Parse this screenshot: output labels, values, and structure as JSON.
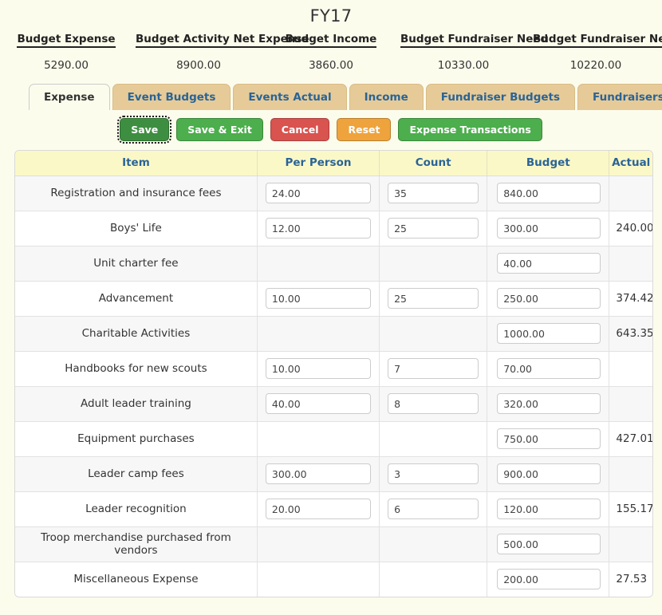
{
  "title": "FY17",
  "summary": {
    "headers": [
      "Budget Expense",
      "Budget Activity Net Expense",
      "Budget Income",
      "Budget Fundraiser Need",
      "Budget Fundraiser Net Income"
    ],
    "values": [
      "5290.00",
      "8900.00",
      "3860.00",
      "10330.00",
      "10220.00"
    ]
  },
  "tabs": [
    {
      "label": "Expense",
      "active": true
    },
    {
      "label": "Event Budgets",
      "active": false
    },
    {
      "label": "Events Actual",
      "active": false
    },
    {
      "label": "Income",
      "active": false
    },
    {
      "label": "Fundraiser Budgets",
      "active": false
    },
    {
      "label": "Fundraisers Actual",
      "active": false
    }
  ],
  "buttons": [
    {
      "label": "Save",
      "style": "save"
    },
    {
      "label": "Save & Exit",
      "style": "green"
    },
    {
      "label": "Cancel",
      "style": "red"
    },
    {
      "label": "Reset",
      "style": "orange"
    },
    {
      "label": "Expense Transactions",
      "style": "green"
    }
  ],
  "table": {
    "columns": [
      "Item",
      "Per Person",
      "Count",
      "Budget",
      "Actual"
    ],
    "rows": [
      {
        "item": "Registration and insurance fees",
        "per_person": "24.00",
        "count": "35",
        "budget": "840.00",
        "actual": ""
      },
      {
        "item": "Boys' Life",
        "per_person": "12.00",
        "count": "25",
        "budget": "300.00",
        "actual": "240.00"
      },
      {
        "item": "Unit charter fee",
        "per_person": null,
        "count": null,
        "budget": "40.00",
        "actual": ""
      },
      {
        "item": "Advancement",
        "per_person": "10.00",
        "count": "25",
        "budget": "250.00",
        "actual": "374.42"
      },
      {
        "item": "Charitable Activities",
        "per_person": null,
        "count": null,
        "budget": "1000.00",
        "actual": "643.35"
      },
      {
        "item": "Handbooks for new scouts",
        "per_person": "10.00",
        "count": "7",
        "budget": "70.00",
        "actual": ""
      },
      {
        "item": "Adult leader training",
        "per_person": "40.00",
        "count": "8",
        "budget": "320.00",
        "actual": ""
      },
      {
        "item": "Equipment purchases",
        "per_person": null,
        "count": null,
        "budget": "750.00",
        "actual": "427.01"
      },
      {
        "item": "Leader camp fees",
        "per_person": "300.00",
        "count": "3",
        "budget": "900.00",
        "actual": ""
      },
      {
        "item": "Leader recognition",
        "per_person": "20.00",
        "count": "6",
        "budget": "120.00",
        "actual": "155.17"
      },
      {
        "item": "Troop merchandise purchased from vendors",
        "per_person": null,
        "count": null,
        "budget": "500.00",
        "actual": ""
      },
      {
        "item": "Miscellaneous Expense",
        "per_person": null,
        "count": null,
        "budget": "200.00",
        "actual": "27.53"
      }
    ]
  },
  "colors": {
    "page_background": "#fcfced",
    "tab_inactive": "#e6cb99",
    "tab_active": "#fcfced",
    "header_cell": "#fbf8c8",
    "header_text": "#2a6496",
    "button_green": "#4cae4c",
    "button_save_green": "#3e8e41",
    "button_red": "#d9534f",
    "button_orange": "#efa33c",
    "row_stripe": "#f7f7f7"
  }
}
